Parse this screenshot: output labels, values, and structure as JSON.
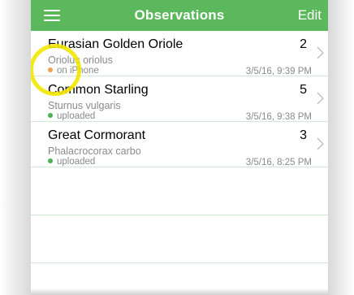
{
  "navbar": {
    "title": "Observations",
    "edit_label": "Edit",
    "menu_icon": "hamburger-menu-icon",
    "color": "#5cb85c"
  },
  "observations": [
    {
      "common_name": "Eurasian Golden Oriole",
      "scientific_name": "Oriolus oriolus",
      "count": "2",
      "status": "on iPhone",
      "status_color": "#f0a050",
      "datetime": "3/5/16, 9:39 PM"
    },
    {
      "common_name": "Common Starling",
      "scientific_name": "Sturnus vulgaris",
      "count": "5",
      "status": "uploaded",
      "status_color": "#4caf50",
      "datetime": "3/5/16, 9:38 PM"
    },
    {
      "common_name": "Great Cormorant",
      "scientific_name": "Phalacrocorax carbo",
      "count": "3",
      "status": "uploaded",
      "status_color": "#4caf50",
      "datetime": "3/5/16, 8:25 PM"
    }
  ],
  "icons": {
    "row_chevron": "chevron-right-icon",
    "highlight": "touch-highlight-ring"
  }
}
